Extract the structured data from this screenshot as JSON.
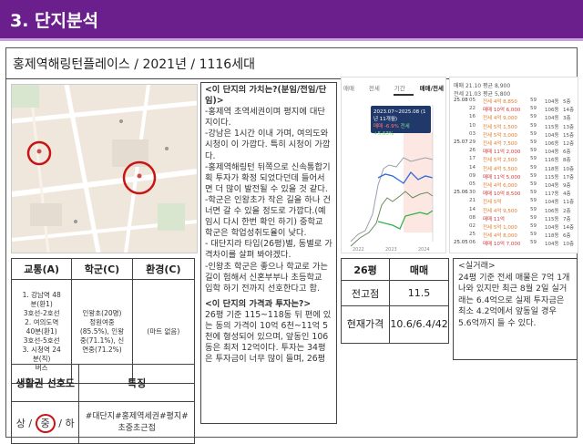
{
  "header": {
    "title": "3. 단지분석"
  },
  "complex": {
    "name": "홍제역해링턴플레이스",
    "year": "2021년",
    "units": "1116세대",
    "sep": "/"
  },
  "desc": {
    "p1_title": "<이 단지의 가치는?(분임/전임/단임)>",
    "p1": [
      "-홍제역 초역세권이며 평지에 대단지이다.",
      "-강남은 1시간 이내 가며, 여의도와 시청이 이 가깝다. 특히 시청이 가깝다.",
      "-홍제역해링턴 뒤쪽으로 신속통합기획 투자가 확정 되었다던데 들어서면 더 많이 발전될 수 있을 것 같다.",
      "-학군은 인왕초가 작은 길을 하나 건너면 갈 수 있을 정도로 가깝다.(예임시 다시 한번 확인 하기) 중학교 학군은 학업성취도율이 낮다.",
      "- 대단지라 타입(26평)별, 동별로 가격차이를 살펴 봐야겠다.",
      "-인왕초 학군은 좋으나 학교로 가는 길이 험해서 신혼부부나 초등학교 입학 하기 전까지 선호한다고 함."
    ],
    "p2_title": "<이 단지의 가격과 투자는?>",
    "p2": [
      "26평 기준 115~118동 뒤 편에 있는 동의 가격이 10억 6천~11억 5천에 형성되어 있으며, 앞동인 106동은 최저 12억이다. 투자는 34평은 투자금이 너무 많이 들며, 26평"
    ]
  },
  "chart": {
    "tabs": [
      "매매",
      "전세",
      "기간",
      "매매/전세"
    ],
    "active_tab": "매매/전세",
    "tooltip_date": "2023.07~2025.08 (1년 11개월)",
    "tooltip_sale": "매매 -6.9%",
    "tooltip_rent": "전세 +5.63%",
    "x_labels": [
      "2022",
      "2023",
      "2024"
    ]
  },
  "transactions": {
    "header_line1": "매매 21.10 평균 8,900",
    "header_line2": "전세 21.03 평균 5,800",
    "rows": [
      {
        "date": "25.08",
        "day": "05",
        "type": "전세 4억 8,850",
        "floor": "59",
        "dong": "104동",
        "fl": "5층"
      },
      {
        "date": "",
        "day": "22",
        "type": "매매 10억 6,000",
        "floor": "59",
        "dong": "106동",
        "fl": "14층"
      },
      {
        "date": "",
        "day": "16",
        "type": "전세 4억 9,000",
        "floor": "59",
        "dong": "104동",
        "fl": "3층"
      },
      {
        "date": "",
        "day": "10",
        "type": "전세 5억 1,500",
        "floor": "59",
        "dong": "115동",
        "fl": "13층"
      },
      {
        "date": "",
        "day": "03",
        "type": "전세 5억 3,000",
        "floor": "59",
        "dong": "104동",
        "fl": "15층"
      },
      {
        "date": "25.07",
        "day": "29",
        "type": "전세 4억 7,500",
        "floor": "59",
        "dong": "106동",
        "fl": "12층"
      },
      {
        "date": "",
        "day": "26",
        "type": "매매 11억 2,000",
        "floor": "59",
        "dong": "104동",
        "fl": "6층"
      },
      {
        "date": "",
        "day": "17",
        "type": "전세 5억 2,500",
        "floor": "59",
        "dong": "116동",
        "fl": "8층"
      },
      {
        "date": "",
        "day": "14",
        "type": "전세 4억 5,500",
        "floor": "59",
        "dong": "118동",
        "fl": "10층"
      },
      {
        "date": "",
        "day": "09",
        "type": "매매 11억 5,000",
        "floor": "59",
        "dong": "115동",
        "fl": "17층"
      },
      {
        "date": "",
        "day": "05",
        "type": "전세 4억 6,000",
        "floor": "59",
        "dong": "104동",
        "fl": "9층"
      },
      {
        "date": "25.06",
        "day": "30",
        "type": "매매 10억 8,500",
        "floor": "59",
        "dong": "117동",
        "fl": "4층"
      },
      {
        "date": "",
        "day": "21",
        "type": "전세 5억",
        "floor": "59",
        "dong": "104동",
        "fl": "11층"
      },
      {
        "date": "",
        "day": "14",
        "type": "전세 4억 9,500",
        "floor": "59",
        "dong": "106동",
        "fl": "2층"
      },
      {
        "date": "",
        "day": "08",
        "type": "매매 11억",
        "floor": "59",
        "dong": "115동",
        "fl": "7층"
      },
      {
        "date": "",
        "day": "02",
        "type": "전세 5억 1,000",
        "floor": "59",
        "dong": "104동",
        "fl": "14층"
      },
      {
        "date": "",
        "day": "25",
        "type": "전세 4억 8,000",
        "floor": "59",
        "dong": "118동",
        "fl": "6층"
      },
      {
        "date": "25.05",
        "day": "06",
        "type": "매매 10억 7,000",
        "floor": "59",
        "dong": "104동",
        "fl": "10층"
      }
    ]
  },
  "grid1": {
    "headers": [
      "교통(A)",
      "학군(C)",
      "환경(C)"
    ],
    "traffic": [
      "1. 강남역 48",
      "분(환1)",
      "3호선-2호선",
      "2. 여의도역",
      "40분(환1)",
      "3호선-5호선",
      "3. 시청역 24",
      "분(직)",
      "버스"
    ],
    "school": [
      "인왕초(20명)",
      "정원여중",
      "(85.5%), 인왕",
      "중(71.1%), 신",
      "연중(71.2%)"
    ],
    "env": "(마트 없음)"
  },
  "grid2": {
    "h1": "생활권 선호도",
    "h2": "특징",
    "pref_pre": "상",
    "pref_mid": "중",
    "pref_post": "/ 하",
    "pref_slash": "/",
    "features": "#대단지#홍제역세권#평지#초중초근접"
  },
  "price": {
    "headers": [
      "26평",
      "매매"
    ],
    "rows": [
      {
        "label": "전고점",
        "value": "11.5"
      },
      {
        "label": "현재가격",
        "value": "10.6/6.4/42"
      }
    ]
  },
  "note": {
    "title": "<실거래>",
    "body": "24평 기준 전세 매물은 7억 1개 나와 있지만 최근 8월 2일 실거래는 6.4억으로 실제 투자금은 최소 4.2억에서 앞동일 경우 5.6억까지 들 수 있다."
  }
}
